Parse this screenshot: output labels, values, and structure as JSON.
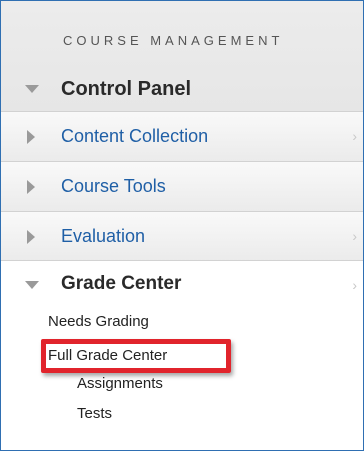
{
  "menu": {
    "heading": "COURSE MANAGEMENT",
    "control_panel": "Control Panel",
    "items": [
      {
        "label": "Content Collection"
      },
      {
        "label": "Course Tools"
      },
      {
        "label": "Evaluation"
      }
    ],
    "grade_center": {
      "title": "Grade Center",
      "subitems": [
        "Needs Grading",
        "Full Grade Center",
        "Assignments",
        "Tests"
      ]
    },
    "chevron": "›"
  },
  "colors": {
    "link": "#1f5fa6",
    "highlight_border": "#e1242c",
    "frame_border": "#2f6fb2"
  },
  "icons": {
    "expanded": "triangle-down-icon",
    "collapsed": "triangle-right-icon",
    "more": "chevron-right-icon"
  }
}
